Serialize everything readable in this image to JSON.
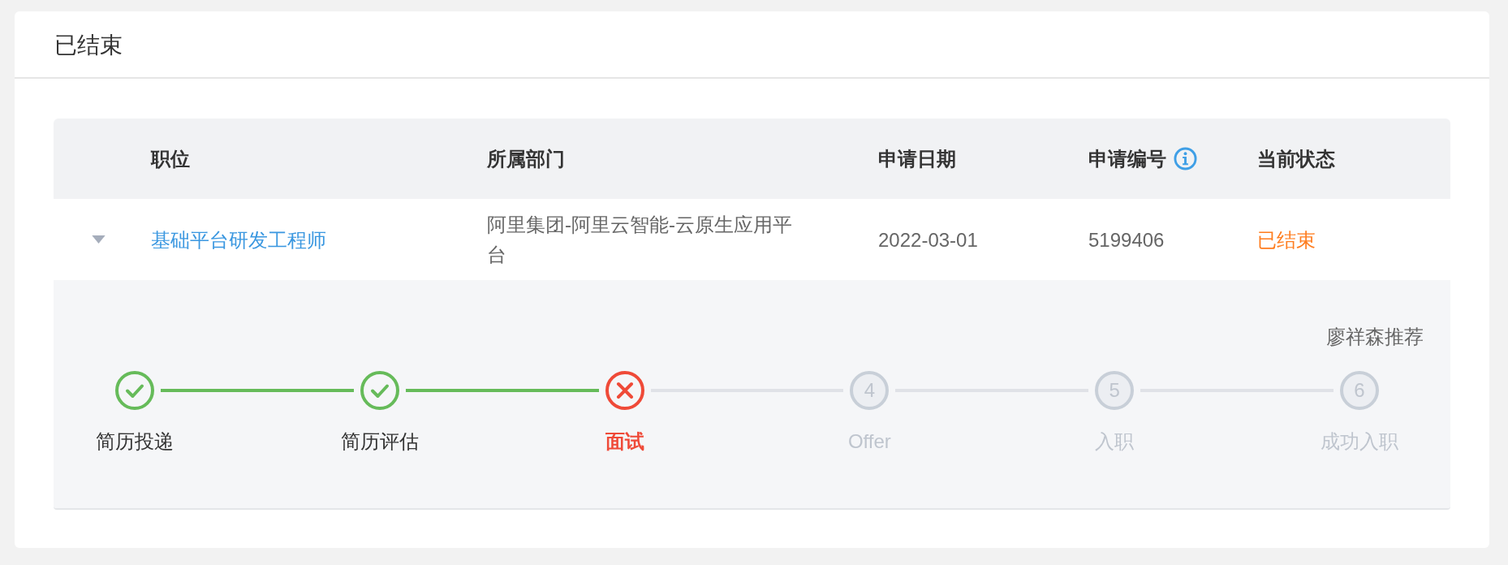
{
  "card": {
    "title": "已结束"
  },
  "table": {
    "columns": [
      {
        "label": "职位",
        "info_icon": false
      },
      {
        "label": "所属部门",
        "info_icon": false
      },
      {
        "label": "申请日期",
        "info_icon": false
      },
      {
        "label": "申请编号",
        "info_icon": true
      },
      {
        "label": "当前状态",
        "info_icon": false
      }
    ],
    "rows": [
      {
        "expanded": true,
        "position": "基础平台研发工程师",
        "department": "阿里集团-阿里云智能-云原生应用平台",
        "date": "2022-03-01",
        "number": "5199406",
        "status": "已结束",
        "detail": {
          "referrer": "廖祥森推荐",
          "steps": [
            {
              "label": "简历投递",
              "kind": "done"
            },
            {
              "label": "简历评估",
              "kind": "done"
            },
            {
              "label": "面试",
              "kind": "failed"
            },
            {
              "label": "Offer",
              "kind": "pending",
              "number": "4"
            },
            {
              "label": "入职",
              "kind": "pending",
              "number": "5"
            },
            {
              "label": "成功入职",
              "kind": "pending",
              "number": "6"
            }
          ]
        }
      }
    ]
  }
}
